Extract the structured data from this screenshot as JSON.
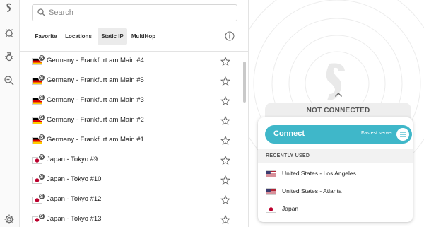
{
  "search": {
    "placeholder": "Search"
  },
  "tabs": [
    {
      "label": "Favorite"
    },
    {
      "label": "Locations"
    },
    {
      "label": "Static IP"
    },
    {
      "label": "MultiHop"
    }
  ],
  "servers": [
    {
      "flag": "de",
      "badge": "S",
      "label": "Germany - Frankfurt am Main #4"
    },
    {
      "flag": "de",
      "badge": "S",
      "label": "Germany - Frankfurt am Main #5"
    },
    {
      "flag": "de",
      "badge": "S",
      "label": "Germany - Frankfurt am Main #3"
    },
    {
      "flag": "de",
      "badge": "S",
      "label": "Germany - Frankfurt am Main #2"
    },
    {
      "flag": "de",
      "badge": "S",
      "label": "Germany - Frankfurt am Main #1"
    },
    {
      "flag": "jp",
      "badge": "S",
      "label": "Japan - Tokyo #9"
    },
    {
      "flag": "jp",
      "badge": "S",
      "label": "Japan - Tokyo #10"
    },
    {
      "flag": "jp",
      "badge": "S",
      "label": "Japan - Tokyo #12"
    },
    {
      "flag": "jp",
      "badge": "S",
      "label": "Japan - Tokyo #13"
    }
  ],
  "status": {
    "text": "NOT CONNECTED"
  },
  "connect": {
    "label": "Connect",
    "sub": "Fastest server"
  },
  "recent": {
    "heading": "RECENTLY USED",
    "items": [
      {
        "flag": "us",
        "label": "United States - Los Angeles"
      },
      {
        "flag": "us",
        "label": "United States - Atlanta"
      },
      {
        "flag": "jp",
        "label": "Japan"
      }
    ]
  },
  "colors": {
    "accent": "#3fb7c9",
    "status_bg": "#eeeeee",
    "tab_active_bg": "#ebebeb"
  }
}
